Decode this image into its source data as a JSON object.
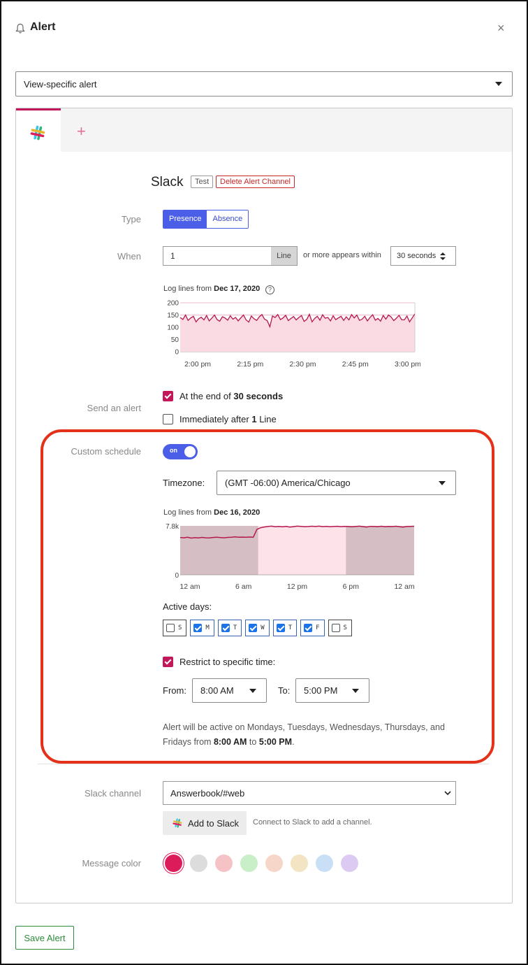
{
  "header": {
    "title": "Alert",
    "close_icon": "×"
  },
  "alert_scope": {
    "value": "View-specific alert"
  },
  "tabs": {
    "plus_label": "+"
  },
  "channel": {
    "name": "Slack",
    "test_label": "Test",
    "delete_label": "Delete Alert Channel"
  },
  "type": {
    "label": "Type",
    "options": [
      "Presence",
      "Absence"
    ],
    "selected": "Presence"
  },
  "when": {
    "label": "When",
    "count": "1",
    "unit": "Line",
    "connector": "or more appears within",
    "window": "30 seconds"
  },
  "chart1": {
    "caption_prefix": "Log lines from",
    "caption_date": "Dec 17, 2020",
    "help_icon": "?"
  },
  "send_alert": {
    "label": "Send an alert",
    "opt1_prefix": "At the end of",
    "opt1_value": "30 seconds",
    "opt1_checked": true,
    "opt2_prefix": "Immediately after",
    "opt2_value": "1",
    "opt2_suffix": "Line",
    "opt2_checked": false
  },
  "custom_schedule": {
    "label": "Custom schedule",
    "toggle_label": "on",
    "enabled": true,
    "timezone_label": "Timezone:",
    "timezone_value": "(GMT -06:00) America/Chicago",
    "chart_caption_prefix": "Log lines from",
    "chart_caption_date": "Dec 16, 2020",
    "active_days_label": "Active days:",
    "days": [
      {
        "letter": "S",
        "checked": false
      },
      {
        "letter": "M",
        "checked": true
      },
      {
        "letter": "T",
        "checked": true
      },
      {
        "letter": "W",
        "checked": true
      },
      {
        "letter": "T",
        "checked": true
      },
      {
        "letter": "F",
        "checked": true
      },
      {
        "letter": "S",
        "checked": false
      }
    ],
    "restrict_label": "Restrict to specific time:",
    "restrict_checked": true,
    "from_label": "From:",
    "from_value": "8:00 AM",
    "to_label": "To:",
    "to_value": "5:00 PM",
    "summary_prefix": "Alert will be active on Mondays, Tuesdays, Wednesdays, Thursdays, and Fridays from",
    "summary_from": "8:00 AM",
    "summary_to_word": "to",
    "summary_to": "5:00 PM",
    "summary_end": "."
  },
  "slack_channel": {
    "label": "Slack channel",
    "value": "Answerbook/#web",
    "add_label": "Add to Slack",
    "add_hint": "Connect to Slack to add a channel."
  },
  "message_color": {
    "label": "Message color",
    "colors": [
      "#dc1c5a",
      "#dcdcdc",
      "#f5c3c6",
      "#c9efc9",
      "#f5d6c8",
      "#f3e4c3",
      "#c9dff5",
      "#dccaf3"
    ],
    "selected_index": 0
  },
  "footer": {
    "save_label": "Save Alert"
  },
  "chart_data": [
    {
      "type": "area",
      "title": "Log lines from Dec 17, 2020",
      "x_ticks": [
        "2:00 pm",
        "2:15 pm",
        "2:30 pm",
        "2:45 pm",
        "3:00 pm"
      ],
      "y_ticks": [
        200,
        150,
        100,
        50,
        0
      ],
      "ylim": [
        0,
        200
      ],
      "x_range_minutes": [
        0,
        67
      ],
      "values": [
        140,
        132,
        150,
        128,
        138,
        145,
        122,
        135,
        141,
        130,
        148,
        126,
        137,
        150,
        131,
        125,
        143,
        138,
        129,
        147,
        133,
        140,
        126,
        139,
        150,
        130,
        121,
        146,
        135,
        128,
        143,
        152,
        133,
        127,
        102,
        146,
        140,
        152,
        131,
        138,
        149,
        127,
        136,
        144,
        130,
        140,
        148,
        124,
        132,
        153,
        122,
        136,
        145,
        129,
        151,
        137,
        140,
        126,
        147,
        131,
        138,
        145,
        128,
        143,
        130,
        152,
        138,
        150,
        128,
        133,
        145,
        126,
        140,
        151,
        129,
        136,
        125,
        148,
        133,
        150,
        142,
        127,
        137,
        149,
        131,
        130,
        146,
        122,
        138,
        155
      ],
      "series_color": "#b5174f",
      "fill_color": "#fadbe3",
      "grid": true
    },
    {
      "type": "area",
      "title": "Log lines from Dec 16, 2020",
      "x_ticks": [
        "12 am",
        "6 am",
        "12 pm",
        "6 pm",
        "12 am"
      ],
      "y_ticks": [
        "7.8k",
        "0"
      ],
      "ylim": [
        0,
        7800
      ],
      "x_range_hours": [
        0,
        24
      ],
      "values": [
        5950,
        5900,
        5980,
        5850,
        5920,
        5880,
        5960,
        5900,
        5870,
        5950,
        6000,
        5930,
        5890,
        5960,
        5980,
        6050,
        5990,
        6010,
        5980,
        6020,
        6000,
        7250,
        7500,
        7620,
        7700,
        7760,
        7650,
        7700,
        7640,
        7710,
        7600,
        7680,
        7750,
        7720,
        7650,
        7690,
        7740,
        7700,
        7760,
        7680,
        7720,
        7650,
        7700,
        7730,
        7680,
        7710,
        7690,
        7640,
        7700,
        7750,
        7680,
        7600,
        7720,
        7700,
        7660,
        7740,
        7650,
        7700,
        7690,
        7740,
        7660,
        7610,
        7700,
        7720,
        7740
      ],
      "inactive_ranges_hours": [
        [
          0,
          8
        ],
        [
          17,
          24
        ]
      ],
      "series_color": "#b5174f",
      "active_fill": "#fde2ea",
      "inactive_fill": "#d6bfc4"
    }
  ]
}
